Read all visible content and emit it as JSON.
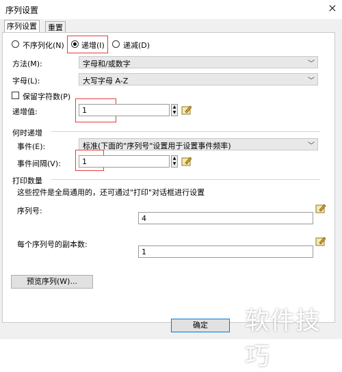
{
  "window": {
    "title": "序列设置",
    "close_glyph": "×"
  },
  "tabs": [
    {
      "label": "序列设置"
    },
    {
      "label": "重置"
    }
  ],
  "mode_options": [
    {
      "label": "不序列化(N)",
      "selected": false
    },
    {
      "label": "递增(I)",
      "selected": true
    },
    {
      "label": "递减(D)",
      "selected": false
    }
  ],
  "method": {
    "label": "方法(M):",
    "value": "字母和/或数字"
  },
  "letters": {
    "label": "字母(L):",
    "value": "大写字母 A-Z"
  },
  "keep_chars": {
    "label": "保留字符数(P)",
    "checked": false
  },
  "increment": {
    "label": "递增值:",
    "value": "1"
  },
  "when_increment": {
    "group_title": "何时递增",
    "event_label": "事件(E):",
    "event_value": "标准(下面的\"序列号\"设置用于设置事件频率)",
    "interval_label": "事件间隔(V):",
    "interval_value": "1"
  },
  "print_count": {
    "group_title": "打印数量",
    "note": "这些控件是全局通用的，还可通过\"打印\"对话框进行设置",
    "serial_label": "序列号:",
    "serial_value": "4",
    "copies_label": "每个序列号的副本数:",
    "copies_value": "1"
  },
  "preview_button": "预览序列(W)...",
  "ok_button": "确定",
  "watermark": "软件技巧",
  "colors": {
    "highlight_box": "#e23c3c",
    "dialog_bg": "#f0f0f0"
  }
}
